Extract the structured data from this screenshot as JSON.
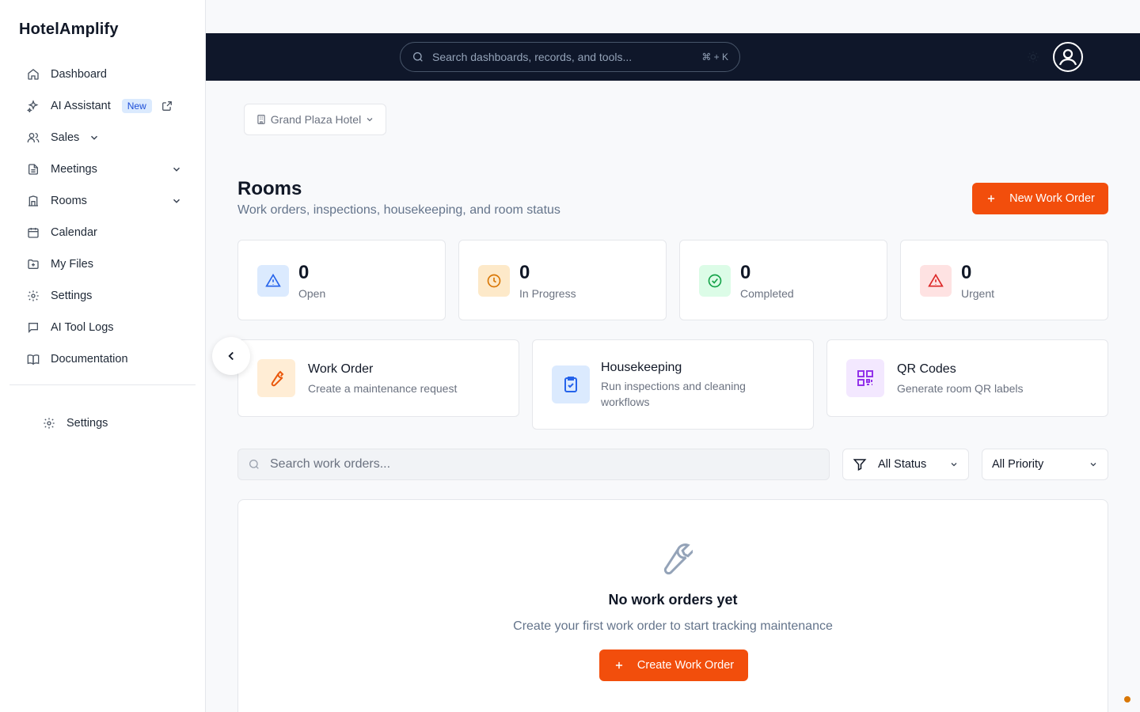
{
  "app": {
    "brand": "HotelAmplify"
  },
  "sidebar": {
    "items": [
      {
        "label": "Dashboard",
        "icon": "home-icon"
      },
      {
        "label": "AI Assistant",
        "icon": "sparkles-icon",
        "badge": "New"
      },
      {
        "label": "Sales",
        "icon": "users-icon"
      },
      {
        "label": "Meetings",
        "icon": "document-icon"
      },
      {
        "label": "Rooms",
        "icon": "building-icon"
      },
      {
        "label": "Calendar",
        "icon": "calendar-icon"
      },
      {
        "label": "My Files",
        "icon": "folder-icon"
      },
      {
        "label": "Settings",
        "icon": "gear-icon"
      },
      {
        "label": "AI Tool Logs",
        "icon": "chat-icon"
      },
      {
        "label": "Documentation",
        "icon": "book-icon"
      }
    ],
    "bottom_settings": "Settings"
  },
  "topbar": {
    "search_placeholder": "Search dashboards, records, and tools...",
    "shortcut": "⌘ + K"
  },
  "hotel_selector": {
    "value": "Grand Plaza Hotel"
  },
  "header": {
    "title": "Rooms",
    "subtitle": "Work orders, inspections, housekeeping, and room status",
    "new_button": "New Work Order"
  },
  "stats": [
    {
      "value": "0",
      "label": "Open",
      "color": "#2563eb",
      "bg": "#dbeafe"
    },
    {
      "value": "0",
      "label": "In Progress",
      "color": "#d97706",
      "bg": "#fde9c9"
    },
    {
      "value": "0",
      "label": "Completed",
      "color": "#16a34a",
      "bg": "#dcfce7"
    },
    {
      "value": "0",
      "label": "Urgent",
      "color": "#dc2626",
      "bg": "#fee2e2"
    }
  ],
  "actions": [
    {
      "title": "Work Order",
      "desc": "Create a maintenance request",
      "color": "#ea580c",
      "bg": "#ffedd5"
    },
    {
      "title": "Housekeeping",
      "desc": "Run inspections and cleaning workflows",
      "color": "#2563eb",
      "bg": "#dbeafe"
    },
    {
      "title": "QR Codes",
      "desc": "Generate room QR labels",
      "color": "#9333ea",
      "bg": "#f3e8ff"
    }
  ],
  "filters": {
    "search_placeholder": "Search work orders...",
    "status": "All Status",
    "priority": "All Priority"
  },
  "empty": {
    "title": "No work orders yet",
    "desc": "Create your first work order to start tracking maintenance",
    "button": "Create Work Order"
  },
  "colors": {
    "accent": "#f24e0c",
    "topbar": "#0f172a"
  }
}
